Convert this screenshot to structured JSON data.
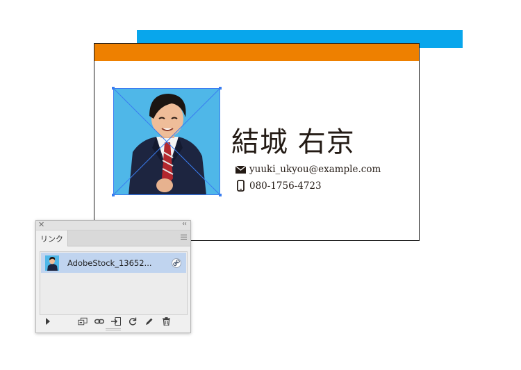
{
  "card": {
    "name": "結城 右京",
    "email": "yuuki_ukyou@example.com",
    "phone": "080-1756-4723",
    "accent_blue": "#08a6ec",
    "accent_orange": "#ee8000",
    "email_icon": "envelope-icon",
    "phone_icon": "smartphone-icon"
  },
  "links_panel": {
    "tab_label": "リンク",
    "items": [
      {
        "label": "AdobeStock_13652...",
        "status_icon": "link-icon",
        "selected": true
      }
    ],
    "toolbar_icons": [
      "show-import-options-icon",
      "relink-from-cc-library-icon",
      "relink-icon",
      "go-to-link-icon",
      "update-link-icon",
      "edit-original-icon",
      "delete-icon"
    ],
    "selection_color": "#c0d4ef"
  }
}
